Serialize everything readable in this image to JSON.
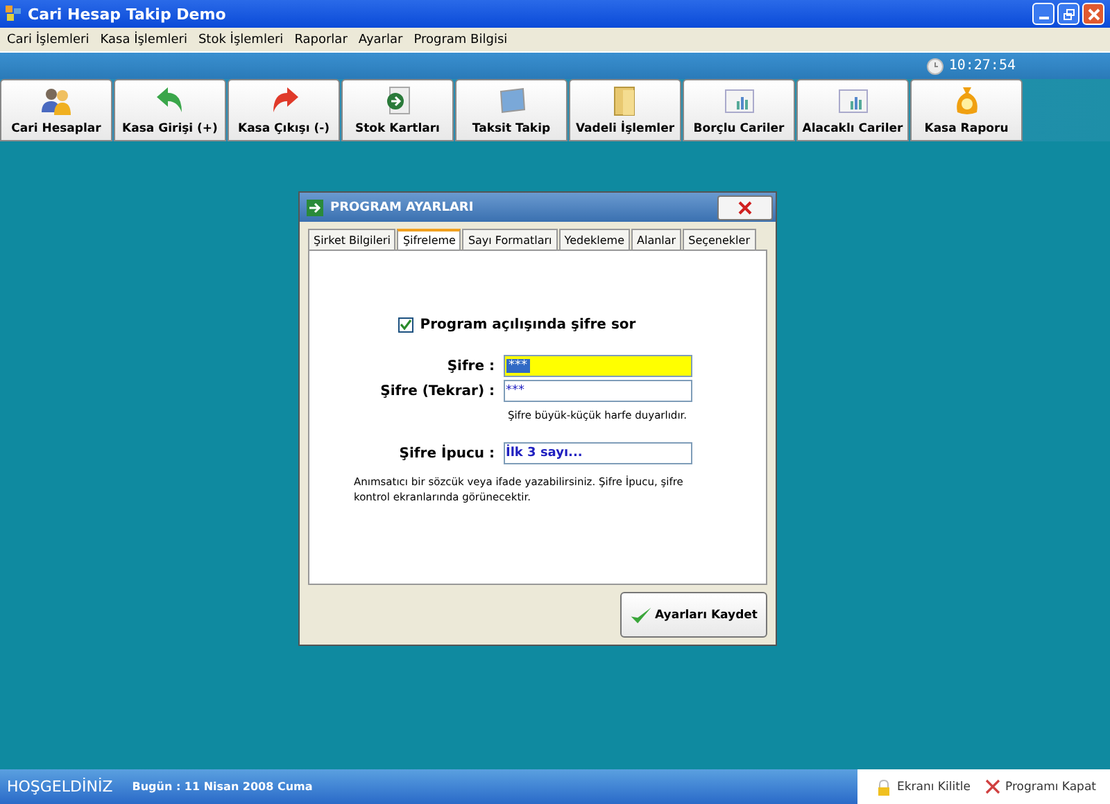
{
  "window": {
    "title": "Cari Hesap Takip Demo"
  },
  "menu": [
    "Cari İşlemleri",
    "Kasa İşlemleri",
    "Stok İşlemleri",
    "Raporlar",
    "Ayarlar",
    "Program Bilgisi"
  ],
  "clock": "10:27:54",
  "toolbar": [
    {
      "label": "Cari Hesaplar"
    },
    {
      "label": "Kasa Girişi (+)"
    },
    {
      "label": "Kasa Çıkışı (-)"
    },
    {
      "label": "Stok Kartları"
    },
    {
      "label": "Taksit Takip"
    },
    {
      "label": "Vadeli İşlemler"
    },
    {
      "label": "Borçlu Cariler"
    },
    {
      "label": "Alacaklı Cariler"
    },
    {
      "label": "Kasa Raporu"
    }
  ],
  "dialog": {
    "title": "PROGRAM AYARLARI",
    "tabs": [
      {
        "label": "Şirket Bilgileri",
        "selected": false
      },
      {
        "label": "Şifreleme",
        "selected": true
      },
      {
        "label": "Sayı Formatları",
        "selected": false
      },
      {
        "label": "Yedekleme",
        "selected": false
      },
      {
        "label": "Alanlar",
        "selected": false
      },
      {
        "label": "Seçenekler",
        "selected": false
      }
    ],
    "ask_password": {
      "label": "Program açılışında şifre sor",
      "checked": true
    },
    "fields": [
      {
        "label": "Şifre :",
        "value": "***",
        "focused": true
      },
      {
        "label": "Şifre (Tekrar) :",
        "value": "***",
        "focused": false
      }
    ],
    "case_note": "Şifre büyük-küçük harfe duyarlıdır.",
    "hint": {
      "label": "Şifre İpucu :",
      "value": "İlk 3 sayı..."
    },
    "hint_note": "Anımsatıcı bir sözcük veya ifade yazabilirsiniz. Şifre İpucu, şifre kontrol ekranlarında görünecektir.",
    "save_button": "Ayarları Kaydet"
  },
  "status_bar": {
    "welcome": "HOŞGELDİNİZ",
    "date": "Bugün : 11 Nisan 2008 Cuma",
    "actions": [
      {
        "kind": "lock",
        "label": "Ekranı Kilitle"
      },
      {
        "kind": "close",
        "label": "Programı Kapat"
      }
    ]
  }
}
